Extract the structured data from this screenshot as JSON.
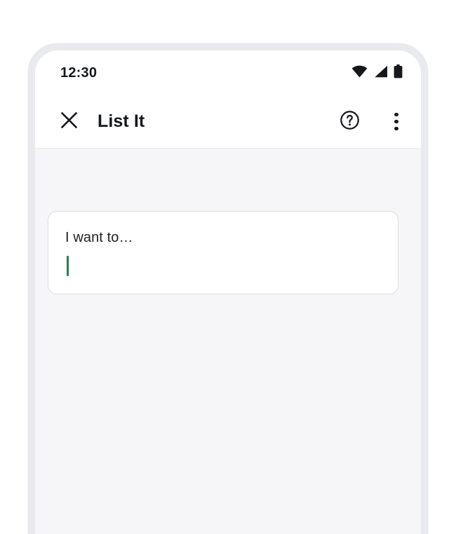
{
  "device": {
    "frame_color": "#e9eaee",
    "screen_background": "#f6f6f9"
  },
  "status_bar": {
    "time": "12:30",
    "icons": [
      {
        "name": "wifi-icon",
        "label": "Wi-Fi"
      },
      {
        "name": "cellular-signal-icon",
        "label": "Cellular signal"
      },
      {
        "name": "battery-icon",
        "label": "Battery"
      }
    ],
    "text_color": "#16181c"
  },
  "toolbar": {
    "close_label": "Close",
    "title": "List It",
    "help_label": "Help",
    "overflow_label": "More options",
    "background": "#ffffff",
    "divider_color": "#ebebee"
  },
  "main": {
    "input_card": {
      "prompt": "I want to…",
      "value": "",
      "caret_color": "#2f7d4f",
      "border_color": "#dcdce2",
      "background": "#ffffff"
    }
  }
}
